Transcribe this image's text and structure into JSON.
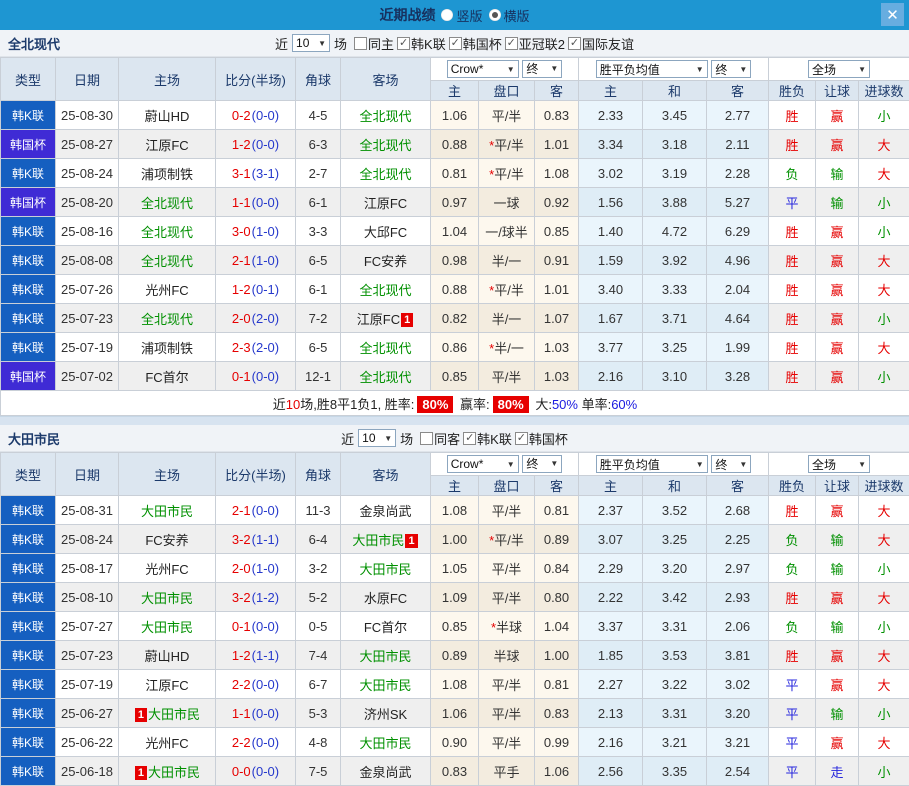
{
  "topbar": {
    "title": "近期战绩",
    "radios": [
      {
        "label": "竖版",
        "on": false
      },
      {
        "label": "横版",
        "on": true
      }
    ],
    "close": "✕"
  },
  "icons": {
    "dropdown_arrow": "▼",
    "check": "✓"
  },
  "colors": {
    "topbar_blue": "#1e96d2",
    "kleague_badge": "#155fc0",
    "cup_badge": "#3f2bd5",
    "win_red": "#e60000",
    "lose_green": "#009000",
    "draw_blue": "#2626dd",
    "team_green": "#009000"
  },
  "header": {
    "type": "类型",
    "date": "日期",
    "home": "主场",
    "score": "比分(半场)",
    "corner": "角球",
    "away": "客场",
    "sub": [
      "主",
      "盘口",
      "客",
      "主",
      "和",
      "客",
      "胜负",
      "让球",
      "进球数"
    ],
    "dd_odds": "Crow*",
    "dd_final": "终",
    "dd_avg": "胜平负均值",
    "dd_scope": "全场"
  },
  "sections": [
    {
      "team": "全北现代",
      "filter": {
        "near": "近",
        "count": "10",
        "after": "场",
        "checks": [
          {
            "label": "同主",
            "on": false
          },
          {
            "label": "韩K联",
            "on": true
          },
          {
            "label": "韩国杯",
            "on": true
          },
          {
            "label": "亚冠联2",
            "on": true
          },
          {
            "label": "国际友谊",
            "on": true
          }
        ]
      },
      "rows": [
        {
          "lg": "韩K联",
          "lgk": "k",
          "date": "25-08-30",
          "home": {
            "t": "蔚山HD"
          },
          "ft": "0-2",
          "ht": "(0-0)",
          "cn": "4-5",
          "away": {
            "t": "全北现代",
            "hl": true
          },
          "o1": "1.06",
          "hs": false,
          "hc": "平/半",
          "o2": "0.83",
          "m1": "2.33",
          "m2": "3.45",
          "m3": "2.77",
          "rs": [
            "胜",
            "r"
          ],
          "lt": [
            "赢",
            "r"
          ],
          "gl": [
            "小",
            "g"
          ]
        },
        {
          "lg": "韩国杯",
          "lgk": "cup",
          "date": "25-08-27",
          "home": {
            "t": "江原FC"
          },
          "ft": "1-2",
          "ht": "(0-0)",
          "cn": "6-3",
          "away": {
            "t": "全北现代",
            "hl": true
          },
          "o1": "0.88",
          "hs": true,
          "hc": "平/半",
          "o2": "1.01",
          "m1": "3.34",
          "m2": "3.18",
          "m3": "2.11",
          "rs": [
            "胜",
            "r"
          ],
          "lt": [
            "赢",
            "r"
          ],
          "gl": [
            "大",
            "r"
          ]
        },
        {
          "lg": "韩K联",
          "lgk": "k",
          "date": "25-08-24",
          "home": {
            "t": "浦项制铁"
          },
          "ft": "3-1",
          "ht": "(3-1)",
          "cn": "2-7",
          "away": {
            "t": "全北现代",
            "hl": true
          },
          "o1": "0.81",
          "hs": true,
          "hc": "平/半",
          "o2": "1.08",
          "m1": "3.02",
          "m2": "3.19",
          "m3": "2.28",
          "rs": [
            "负",
            "g"
          ],
          "lt": [
            "输",
            "g"
          ],
          "gl": [
            "大",
            "r"
          ]
        },
        {
          "lg": "韩国杯",
          "lgk": "cup",
          "date": "25-08-20",
          "home": {
            "t": "全北现代",
            "hl": true
          },
          "ft": "1-1",
          "ht": "(0-0)",
          "cn": "6-1",
          "away": {
            "t": "江原FC"
          },
          "o1": "0.97",
          "hs": false,
          "hc": "一球",
          "o2": "0.92",
          "m1": "1.56",
          "m2": "3.88",
          "m3": "5.27",
          "rs": [
            "平",
            "b"
          ],
          "lt": [
            "输",
            "g"
          ],
          "gl": [
            "小",
            "g"
          ]
        },
        {
          "lg": "韩K联",
          "lgk": "k",
          "date": "25-08-16",
          "home": {
            "t": "全北现代",
            "hl": true
          },
          "ft": "3-0",
          "ht": "(1-0)",
          "cn": "3-3",
          "away": {
            "t": "大邱FC"
          },
          "o1": "1.04",
          "hs": false,
          "hc": "一/球半",
          "o2": "0.85",
          "m1": "1.40",
          "m2": "4.72",
          "m3": "6.29",
          "rs": [
            "胜",
            "r"
          ],
          "lt": [
            "赢",
            "r"
          ],
          "gl": [
            "小",
            "g"
          ]
        },
        {
          "lg": "韩K联",
          "lgk": "k",
          "date": "25-08-08",
          "home": {
            "t": "全北现代",
            "hl": true
          },
          "ft": "2-1",
          "ht": "(1-0)",
          "cn": "6-5",
          "away": {
            "t": "FC安养"
          },
          "o1": "0.98",
          "hs": false,
          "hc": "半/一",
          "o2": "0.91",
          "m1": "1.59",
          "m2": "3.92",
          "m3": "4.96",
          "rs": [
            "胜",
            "r"
          ],
          "lt": [
            "赢",
            "r"
          ],
          "gl": [
            "大",
            "r"
          ]
        },
        {
          "lg": "韩K联",
          "lgk": "k",
          "date": "25-07-26",
          "home": {
            "t": "光州FC"
          },
          "ft": "1-2",
          "ht": "(0-1)",
          "cn": "6-1",
          "away": {
            "t": "全北现代",
            "hl": true
          },
          "o1": "0.88",
          "hs": true,
          "hc": "平/半",
          "o2": "1.01",
          "m1": "3.40",
          "m2": "3.33",
          "m3": "2.04",
          "rs": [
            "胜",
            "r"
          ],
          "lt": [
            "赢",
            "r"
          ],
          "gl": [
            "大",
            "r"
          ]
        },
        {
          "lg": "韩K联",
          "lgk": "k",
          "date": "25-07-23",
          "home": {
            "t": "全北现代",
            "hl": true
          },
          "ft": "2-0",
          "ht": "(2-0)",
          "cn": "7-2",
          "away": {
            "t": "江原FC",
            "b": "1",
            "bp": "after"
          },
          "o1": "0.82",
          "hs": false,
          "hc": "半/一",
          "o2": "1.07",
          "m1": "1.67",
          "m2": "3.71",
          "m3": "4.64",
          "rs": [
            "胜",
            "r"
          ],
          "lt": [
            "赢",
            "r"
          ],
          "gl": [
            "小",
            "g"
          ]
        },
        {
          "lg": "韩K联",
          "lgk": "k",
          "date": "25-07-19",
          "home": {
            "t": "浦项制铁"
          },
          "ft": "2-3",
          "ht": "(2-0)",
          "cn": "6-5",
          "away": {
            "t": "全北现代",
            "hl": true
          },
          "o1": "0.86",
          "hs": true,
          "hc": "半/一",
          "o2": "1.03",
          "m1": "3.77",
          "m2": "3.25",
          "m3": "1.99",
          "rs": [
            "胜",
            "r"
          ],
          "lt": [
            "赢",
            "r"
          ],
          "gl": [
            "大",
            "r"
          ]
        },
        {
          "lg": "韩国杯",
          "lgk": "cup",
          "date": "25-07-02",
          "home": {
            "t": "FC首尔"
          },
          "ft": "0-1",
          "ht": "(0-0)",
          "cn": "12-1",
          "away": {
            "t": "全北现代",
            "hl": true
          },
          "o1": "0.85",
          "hs": false,
          "hc": "平/半",
          "o2": "1.03",
          "m1": "2.16",
          "m2": "3.10",
          "m3": "3.28",
          "rs": [
            "胜",
            "r"
          ],
          "lt": [
            "赢",
            "r"
          ],
          "gl": [
            "小",
            "g"
          ]
        }
      ],
      "summary": [
        {
          "t": "近",
          "s": "d"
        },
        {
          "t": "10",
          "s": "r"
        },
        {
          "t": "场,胜8平1负1, 胜率:",
          "s": "d"
        },
        {
          "t": "80%",
          "s": "badge"
        },
        {
          "t": " 赢率:",
          "s": "d"
        },
        {
          "t": "80%",
          "s": "badge"
        },
        {
          "t": " 大:",
          "s": "d"
        },
        {
          "t": "50%",
          "s": "b"
        },
        {
          "t": " 单率:",
          "s": "d"
        },
        {
          "t": "60%",
          "s": "b"
        }
      ]
    },
    {
      "team": "大田市民",
      "filter": {
        "near": "近",
        "count": "10",
        "after": "场",
        "checks": [
          {
            "label": "同客",
            "on": false
          },
          {
            "label": "韩K联",
            "on": true
          },
          {
            "label": "韩国杯",
            "on": true
          }
        ]
      },
      "rows": [
        {
          "lg": "韩K联",
          "lgk": "k",
          "date": "25-08-31",
          "home": {
            "t": "大田市民",
            "hl": true
          },
          "ft": "2-1",
          "ht": "(0-0)",
          "cn": "11-3",
          "away": {
            "t": "金泉尚武"
          },
          "o1": "1.08",
          "hs": false,
          "hc": "平/半",
          "o2": "0.81",
          "m1": "2.37",
          "m2": "3.52",
          "m3": "2.68",
          "rs": [
            "胜",
            "r"
          ],
          "lt": [
            "赢",
            "r"
          ],
          "gl": [
            "大",
            "r"
          ]
        },
        {
          "lg": "韩K联",
          "lgk": "k",
          "date": "25-08-24",
          "home": {
            "t": "FC安养"
          },
          "ft": "3-2",
          "ht": "(1-1)",
          "cn": "6-4",
          "away": {
            "t": "大田市民",
            "hl": true,
            "b": "1",
            "bp": "after"
          },
          "o1": "1.00",
          "hs": true,
          "hc": "平/半",
          "o2": "0.89",
          "m1": "3.07",
          "m2": "3.25",
          "m3": "2.25",
          "rs": [
            "负",
            "g"
          ],
          "lt": [
            "输",
            "g"
          ],
          "gl": [
            "大",
            "r"
          ]
        },
        {
          "lg": "韩K联",
          "lgk": "k",
          "date": "25-08-17",
          "home": {
            "t": "光州FC"
          },
          "ft": "2-0",
          "ht": "(1-0)",
          "cn": "3-2",
          "away": {
            "t": "大田市民",
            "hl": true
          },
          "o1": "1.05",
          "hs": false,
          "hc": "平/半",
          "o2": "0.84",
          "m1": "2.29",
          "m2": "3.20",
          "m3": "2.97",
          "rs": [
            "负",
            "g"
          ],
          "lt": [
            "输",
            "g"
          ],
          "gl": [
            "小",
            "g"
          ]
        },
        {
          "lg": "韩K联",
          "lgk": "k",
          "date": "25-08-10",
          "home": {
            "t": "大田市民",
            "hl": true
          },
          "ft": "3-2",
          "ht": "(1-2)",
          "cn": "5-2",
          "away": {
            "t": "水原FC"
          },
          "o1": "1.09",
          "hs": false,
          "hc": "平/半",
          "o2": "0.80",
          "m1": "2.22",
          "m2": "3.42",
          "m3": "2.93",
          "rs": [
            "胜",
            "r"
          ],
          "lt": [
            "赢",
            "r"
          ],
          "gl": [
            "大",
            "r"
          ]
        },
        {
          "lg": "韩K联",
          "lgk": "k",
          "date": "25-07-27",
          "home": {
            "t": "大田市民",
            "hl": true
          },
          "ft": "0-1",
          "ht": "(0-0)",
          "cn": "0-5",
          "away": {
            "t": "FC首尔"
          },
          "o1": "0.85",
          "hs": true,
          "hc": "半球",
          "o2": "1.04",
          "m1": "3.37",
          "m2": "3.31",
          "m3": "2.06",
          "rs": [
            "负",
            "g"
          ],
          "lt": [
            "输",
            "g"
          ],
          "gl": [
            "小",
            "g"
          ]
        },
        {
          "lg": "韩K联",
          "lgk": "k",
          "date": "25-07-23",
          "home": {
            "t": "蔚山HD"
          },
          "ft": "1-2",
          "ht": "(1-1)",
          "cn": "7-4",
          "away": {
            "t": "大田市民",
            "hl": true
          },
          "o1": "0.89",
          "hs": false,
          "hc": "半球",
          "o2": "1.00",
          "m1": "1.85",
          "m2": "3.53",
          "m3": "3.81",
          "rs": [
            "胜",
            "r"
          ],
          "lt": [
            "赢",
            "r"
          ],
          "gl": [
            "大",
            "r"
          ]
        },
        {
          "lg": "韩K联",
          "lgk": "k",
          "date": "25-07-19",
          "home": {
            "t": "江原FC"
          },
          "ft": "2-2",
          "ht": "(0-0)",
          "cn": "6-7",
          "away": {
            "t": "大田市民",
            "hl": true
          },
          "o1": "1.08",
          "hs": false,
          "hc": "平/半",
          "o2": "0.81",
          "m1": "2.27",
          "m2": "3.22",
          "m3": "3.02",
          "rs": [
            "平",
            "b"
          ],
          "lt": [
            "赢",
            "r"
          ],
          "gl": [
            "大",
            "r"
          ]
        },
        {
          "lg": "韩K联",
          "lgk": "k",
          "date": "25-06-27",
          "home": {
            "t": "大田市民",
            "hl": true,
            "b": "1",
            "bp": "before"
          },
          "ft": "1-1",
          "ht": "(0-0)",
          "cn": "5-3",
          "away": {
            "t": "济州SK"
          },
          "o1": "1.06",
          "hs": false,
          "hc": "平/半",
          "o2": "0.83",
          "m1": "2.13",
          "m2": "3.31",
          "m3": "3.20",
          "rs": [
            "平",
            "b"
          ],
          "lt": [
            "输",
            "g"
          ],
          "gl": [
            "小",
            "g"
          ]
        },
        {
          "lg": "韩K联",
          "lgk": "k",
          "date": "25-06-22",
          "home": {
            "t": "光州FC"
          },
          "ft": "2-2",
          "ht": "(0-0)",
          "cn": "4-8",
          "away": {
            "t": "大田市民",
            "hl": true
          },
          "o1": "0.90",
          "hs": false,
          "hc": "平/半",
          "o2": "0.99",
          "m1": "2.16",
          "m2": "3.21",
          "m3": "3.21",
          "rs": [
            "平",
            "b"
          ],
          "lt": [
            "赢",
            "r"
          ],
          "gl": [
            "大",
            "r"
          ]
        },
        {
          "lg": "韩K联",
          "lgk": "k",
          "date": "25-06-18",
          "home": {
            "t": "大田市民",
            "hl": true,
            "b": "1",
            "bp": "before"
          },
          "ft": "0-0",
          "ht": "(0-0)",
          "cn": "7-5",
          "away": {
            "t": "金泉尚武"
          },
          "o1": "0.83",
          "hs": false,
          "hc": "平手",
          "o2": "1.06",
          "m1": "2.56",
          "m2": "3.35",
          "m3": "2.54",
          "rs": [
            "平",
            "b"
          ],
          "lt": [
            "走",
            "b"
          ],
          "gl": [
            "小",
            "g"
          ]
        }
      ],
      "summary": null
    }
  ]
}
